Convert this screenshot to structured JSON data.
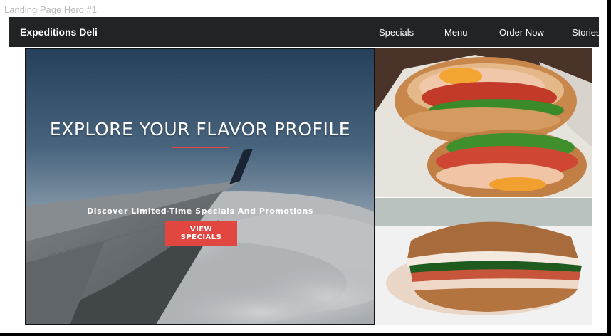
{
  "frame": {
    "label": "Landing Page Hero #1"
  },
  "navbar": {
    "brand": "Expeditions Deli",
    "links": [
      {
        "label": "Specials"
      },
      {
        "label": "Menu"
      },
      {
        "label": "Order Now"
      },
      {
        "label": "Stories"
      }
    ]
  },
  "hero": {
    "title": "EXPLORE YOUR FLAVOR PROFILE",
    "subtitle": "Discover Limited-Time Specials And Promotions",
    "cta_label": "VIEW SPECIALS",
    "accent_color": "#e14640"
  },
  "images": {
    "hero_background": "airplane-wing-above-clouds",
    "top_right": "bagel-sandwich-cut-in-half",
    "bottom_right": "deli-sandwich-on-plate"
  }
}
